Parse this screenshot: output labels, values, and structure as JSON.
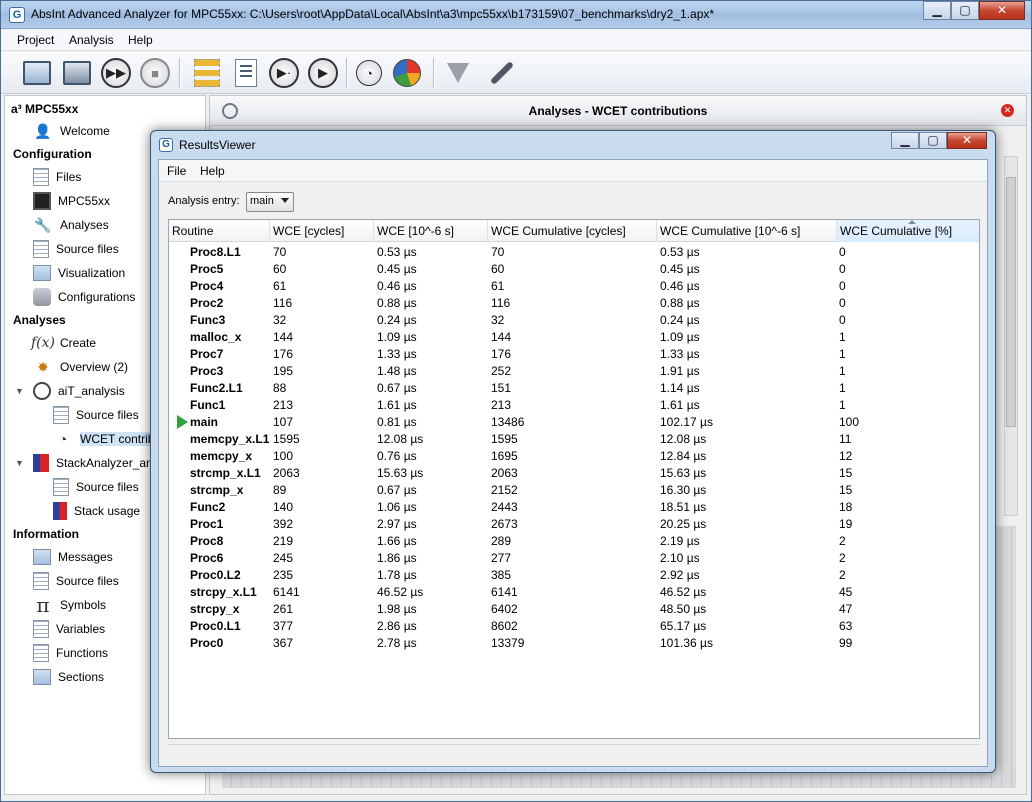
{
  "window": {
    "title": "AbsInt Advanced Analyzer for MPC55xx: C:\\Users\\root\\AppData\\Local\\AbsInt\\a3\\mpc55xx\\b173159\\07_benchmarks\\dry2_1.apx*",
    "app_icon": "G"
  },
  "menu": [
    "Project",
    "Analysis",
    "Help"
  ],
  "toolbar": [
    "new-project-icon",
    "save-icon",
    "run-all-icon",
    "stop-icon",
    "flow-graph-icon",
    "report-icon",
    "step-run-icon",
    "run-icon",
    "timing-icon",
    "pie-chart-icon",
    "filter-icon",
    "wrench-icon"
  ],
  "sidebar": {
    "root": "a³ MPC55xx",
    "welcome": "Welcome",
    "sections": {
      "configuration": "Configuration",
      "analyses": "Analyses",
      "information": "Information"
    },
    "configuration_items": [
      "Files",
      "MPC55xx",
      "Analyses",
      "Source files",
      "Visualization",
      "Configurations"
    ],
    "analyses_items": {
      "create": "Create",
      "create_icon": "f(x)",
      "overview": "Overview (2)",
      "ait": "aiT_analysis",
      "ait_children": [
        "Source files",
        "WCET contributions"
      ],
      "stack": "StackAnalyzer_analysis",
      "stack_children": [
        "Source files",
        "Stack usage"
      ]
    },
    "information_items": [
      "Messages",
      "Source files",
      "Symbols",
      "Variables",
      "Functions",
      "Sections"
    ]
  },
  "analyses_panel": {
    "title": "Analyses - WCET contributions"
  },
  "results_viewer": {
    "title": "ResultsViewer",
    "menu": [
      "File",
      "Help"
    ],
    "entry_label": "Analysis entry:",
    "entry_value": "main",
    "columns": [
      "Routine",
      "WCE [cycles]",
      "WCE [10^-6 s]",
      "WCE Cumulative [cycles]",
      "WCE Cumulative [10^-6 s]",
      "WCE Cumulative [%]"
    ],
    "rows": [
      [
        "Proc8.L1",
        "70",
        "0.53 µs",
        "70",
        "0.53 µs",
        "0"
      ],
      [
        "Proc5",
        "60",
        "0.45 µs",
        "60",
        "0.45 µs",
        "0"
      ],
      [
        "Proc4",
        "61",
        "0.46 µs",
        "61",
        "0.46 µs",
        "0"
      ],
      [
        "Proc2",
        "116",
        "0.88 µs",
        "116",
        "0.88 µs",
        "0"
      ],
      [
        "Func3",
        "32",
        "0.24 µs",
        "32",
        "0.24 µs",
        "0"
      ],
      [
        "malloc_x",
        "144",
        "1.09 µs",
        "144",
        "1.09 µs",
        "1"
      ],
      [
        "Proc7",
        "176",
        "1.33 µs",
        "176",
        "1.33 µs",
        "1"
      ],
      [
        "Proc3",
        "195",
        "1.48 µs",
        "252",
        "1.91 µs",
        "1"
      ],
      [
        "Func2.L1",
        "88",
        "0.67 µs",
        "151",
        "1.14 µs",
        "1"
      ],
      [
        "Func1",
        "213",
        "1.61 µs",
        "213",
        "1.61 µs",
        "1"
      ],
      [
        "main",
        "107",
        "0.81 µs",
        "13486",
        "102.17 µs",
        "100"
      ],
      [
        "memcpy_x.L1",
        "1595",
        "12.08 µs",
        "1595",
        "12.08 µs",
        "11"
      ],
      [
        "memcpy_x",
        "100",
        "0.76 µs",
        "1695",
        "12.84 µs",
        "12"
      ],
      [
        "strcmp_x.L1",
        "2063",
        "15.63 µs",
        "2063",
        "15.63 µs",
        "15"
      ],
      [
        "strcmp_x",
        "89",
        "0.67 µs",
        "2152",
        "16.30 µs",
        "15"
      ],
      [
        "Func2",
        "140",
        "1.06 µs",
        "2443",
        "18.51 µs",
        "18"
      ],
      [
        "Proc1",
        "392",
        "2.97 µs",
        "2673",
        "20.25 µs",
        "19"
      ],
      [
        "Proc8",
        "219",
        "1.66 µs",
        "289",
        "2.19 µs",
        "2"
      ],
      [
        "Proc6",
        "245",
        "1.86 µs",
        "277",
        "2.10 µs",
        "2"
      ],
      [
        "Proc0.L2",
        "235",
        "1.78 µs",
        "385",
        "2.92 µs",
        "2"
      ],
      [
        "strcpy_x.L1",
        "6141",
        "46.52 µs",
        "6141",
        "46.52 µs",
        "45"
      ],
      [
        "strcpy_x",
        "261",
        "1.98 µs",
        "6402",
        "48.50 µs",
        "47"
      ],
      [
        "Proc0.L1",
        "377",
        "2.86 µs",
        "8602",
        "65.17 µs",
        "63"
      ],
      [
        "Proc0",
        "367",
        "2.78 µs",
        "13379",
        "101.36 µs",
        "99"
      ]
    ],
    "current_row": 10
  },
  "colors": {
    "title_bar": "#a8c4e4",
    "close_red": "#c7462f",
    "selection": "#cfe3f7",
    "current_marker": "#2fa13a"
  }
}
